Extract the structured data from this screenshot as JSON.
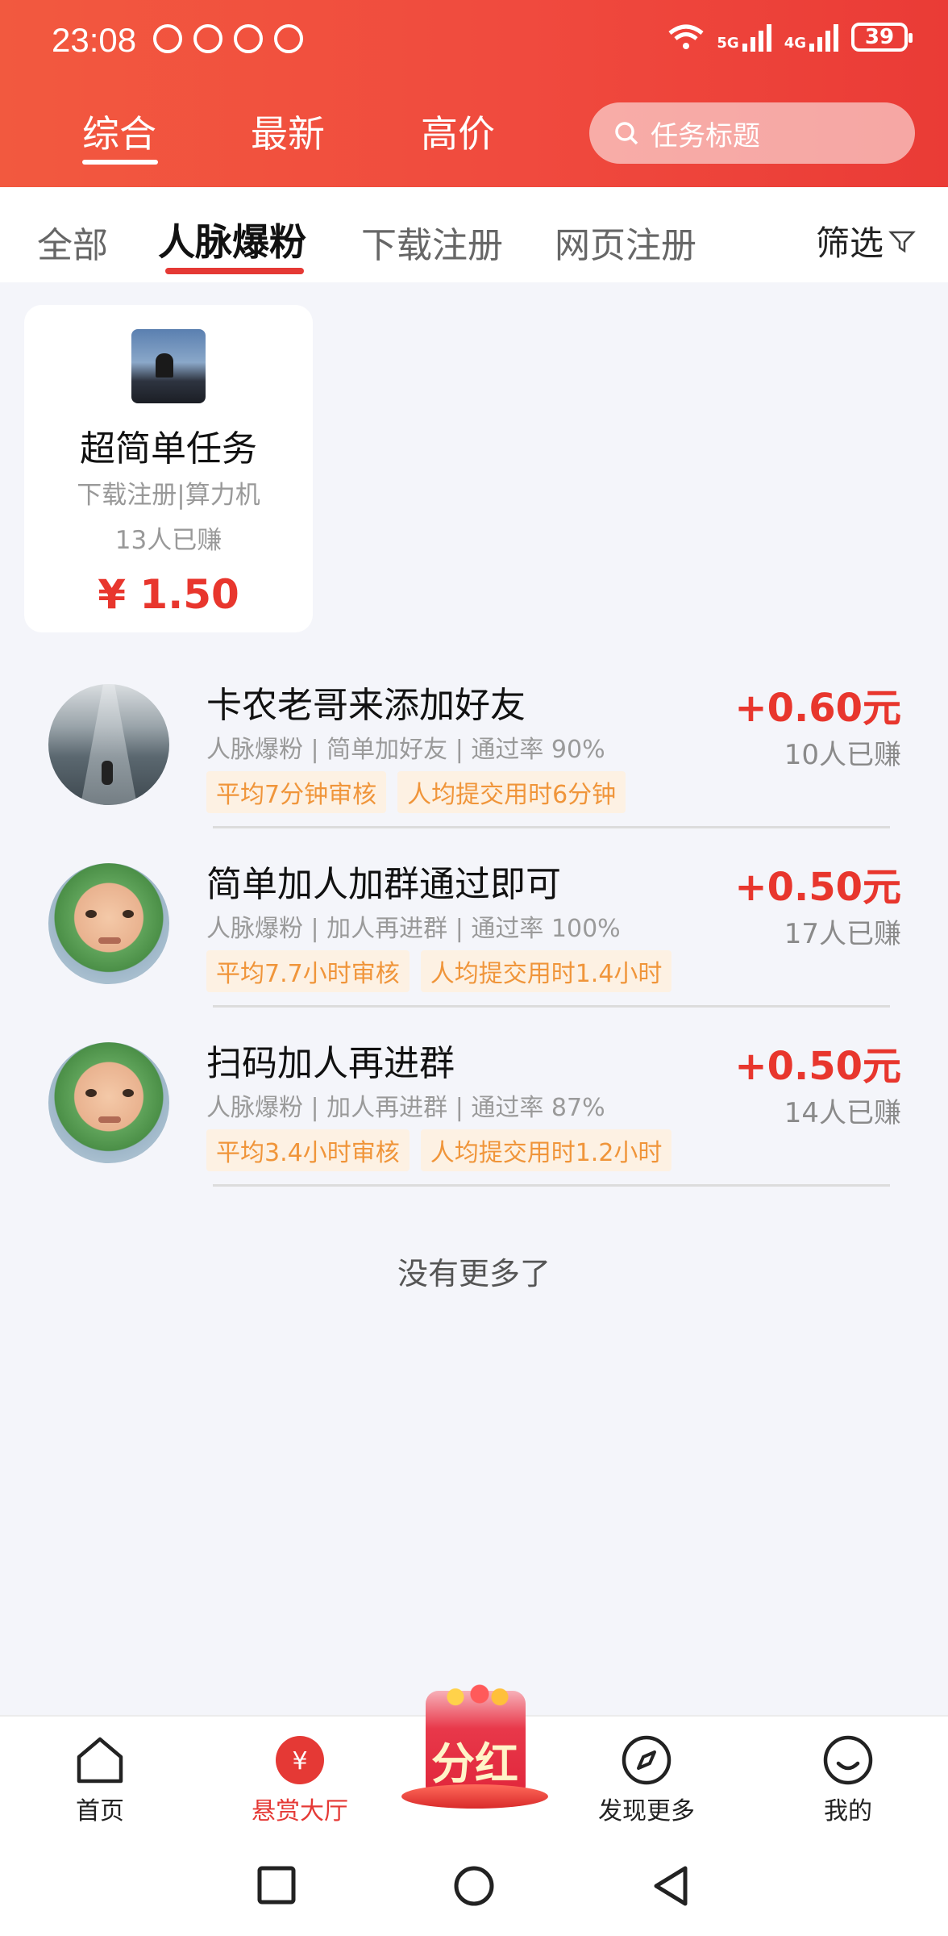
{
  "status_bar": {
    "time": "23:08",
    "network_5g": "5G",
    "network_4g": "4G",
    "battery": "39"
  },
  "top_tabs": [
    "综合",
    "最新",
    "高价"
  ],
  "search": {
    "placeholder": "任务标题"
  },
  "sub_tabs": [
    "全部",
    "人脉爆粉",
    "下载注册",
    "网页注册"
  ],
  "filter_label": "筛选",
  "featured": {
    "title": "超简单任务",
    "subtitle": "下载注册|算力机",
    "count": "13人已赚",
    "price": "¥ 1.50"
  },
  "tasks": [
    {
      "title": "卡农老哥来添加好友",
      "meta": "人脉爆粉 | 简单加好友 | 通过率 90%",
      "tag1": "平均7分钟审核",
      "tag2": "人均提交用时6分钟",
      "price": "+0.60元",
      "count": "10人已赚",
      "avatar_icon": "street-photo"
    },
    {
      "title": "简单加人加群通过即可",
      "meta": "人脉爆粉 | 加人再进群 | 通过率 100%",
      "tag1": "平均7.7小时审核",
      "tag2": "人均提交用时1.4小时",
      "price": "+0.50元",
      "count": "17人已赚",
      "avatar_icon": "baby-photo"
    },
    {
      "title": "扫码加人再进群",
      "meta": "人脉爆粉 | 加人再进群 | 通过率 87%",
      "tag1": "平均3.4小时审核",
      "tag2": "人均提交用时1.2小时",
      "price": "+0.50元",
      "count": "14人已赚",
      "avatar_icon": "baby-photo"
    }
  ],
  "no_more": "没有更多了",
  "bottom_nav": {
    "home": "首页",
    "bounty_hall": "悬赏大厅",
    "dividend": "分红",
    "discover": "发现更多",
    "mine": "我的"
  },
  "colors": {
    "brand_red": "#e8362d",
    "header_gradient_start": "#f2593f",
    "tag_text": "#f0953a",
    "tag_bg": "#fdf1e3"
  }
}
